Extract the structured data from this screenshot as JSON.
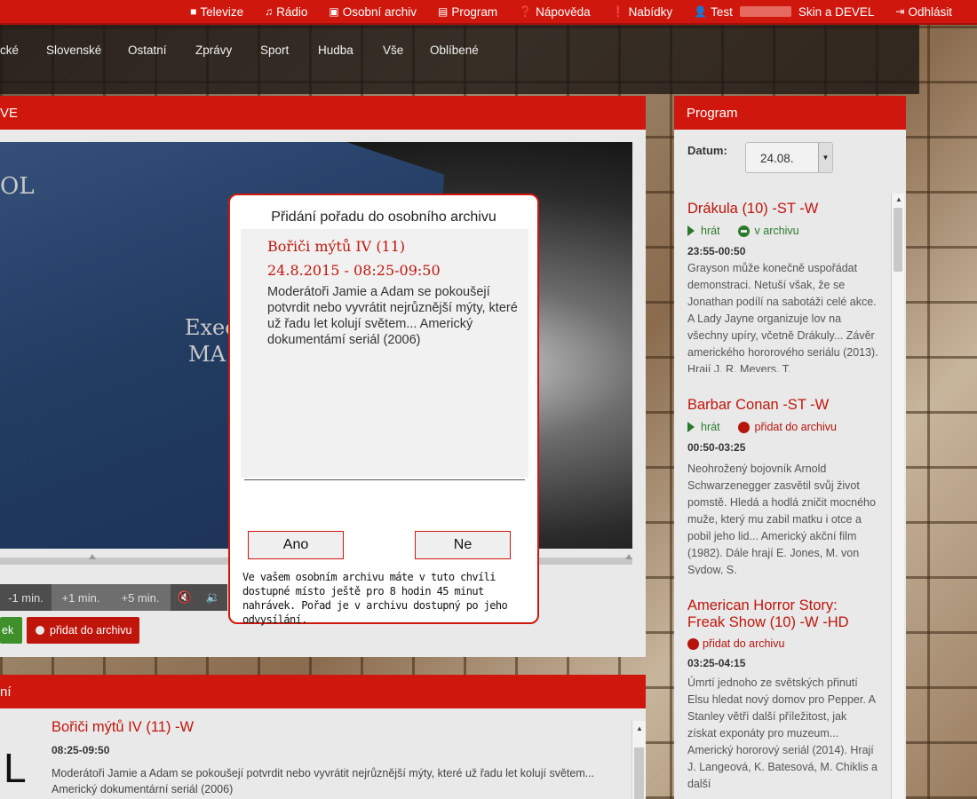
{
  "topnav": {
    "items": [
      {
        "label": "Televize",
        "icon": "video-camera-icon"
      },
      {
        "label": "Rádio",
        "icon": "music-note-icon"
      },
      {
        "label": "Osobní archiv",
        "icon": "archive-box-icon"
      },
      {
        "label": "Program",
        "icon": "list-icon"
      },
      {
        "label": "Nápověda",
        "icon": "question-circle-icon"
      },
      {
        "label": "Nabídky",
        "icon": "exclamation-circle-icon"
      },
      {
        "label": "Test",
        "icon": "user-icon",
        "suffix": "Skin a DEVEL"
      },
      {
        "label": "Odhlásit",
        "icon": "logout-icon"
      }
    ]
  },
  "categories": [
    "cké",
    "Slovenské",
    "Ostatní",
    "Zprávy",
    "Sport",
    "Hudba",
    "Vše",
    "Oblíbené"
  ],
  "player": {
    "header": "VE",
    "video_text_1": "OL",
    "video_text_2": "Exec",
    "video_text_3": "MA",
    "controls": [
      "-1 min.",
      "+1 min.",
      "+5 min."
    ],
    "action_green": "ek",
    "action_red": "přidat do archivu"
  },
  "info": {
    "header": "ní",
    "logo": "L",
    "title": "Bořiči mýtů IV (11) -W",
    "time": "08:25-09:50",
    "desc": "Moderátoři Jamie a Adam se pokoušejí potvrdit nebo vyvrátit nejrůznější mýty, které už řadu let kolují světem... Americký dokumentární seriál (2006)"
  },
  "program": {
    "header": "Program",
    "date_label": "Datum:",
    "date_value": "24.08.",
    "items": [
      {
        "title": "Drákula (10) -ST -W",
        "play": "hrát",
        "status": "v archivu",
        "status_color": "#2b7a2b",
        "time": "23:55-00:50",
        "desc": "Grayson může konečně uspořádat demonstraci. Netuší však, že se Jonathan podílí na sabotáži celé akce. A Lady Jayne organizuje lov na všechny upíry, včetně Drákuly... Závěr amerického hororového seriálu (2013). Hrají J. R. Meyers, T."
      },
      {
        "title": "Barbar Conan -ST -W",
        "play": "hrát",
        "status": "přidat do archivu",
        "status_color": "#b5150d",
        "time": "00:50-03:25",
        "desc": "Neohrožený bojovník Arnold Schwarzenegger zasvětil svůj život pomstě. Hledá a hodlá zničit mocného muže, který mu zabil matku i otce a pobil jeho lid... Americký akční film (1982). Dále hrají E. Jones, M. von Sydow, S."
      },
      {
        "title_line1": "American Horror Story:",
        "title_line2": "Freak Show (10) -W -HD",
        "status": "přidat do archivu",
        "status_color": "#b5150d",
        "time": "03:25-04:15",
        "desc": "Úmrtí jednoho ze světských přinutí Elsu hledat nový domov pro Pepper. A Stanley větří další příležitost, jak získat exponáty pro muzeum... Americký hororový seriál (2014). Hrají J. Langeová, K. Batesová, M. Chiklis a další"
      }
    ]
  },
  "modal": {
    "title": "Přidání pořadu do osobního archivu",
    "name": "Bořiči mýtů IV (11)",
    "datetime": "24.8.2015 - 08:25-09:50",
    "desc": "Moderátoři Jamie a Adam se pokoušejí potvrdit nebo vyvrátit nejrůznější mýty, které už řadu let kolují světem... Americký dokumentámí seriál (2006)",
    "yes": "Ano",
    "no": "Ne",
    "note": "Ve vašem osobním archivu máte v tuto chvíli dostupné místo ještě pro 8 hodin 45 minut nahrávek. Pořad je v archivu dostupný po jeho odvysílání."
  }
}
